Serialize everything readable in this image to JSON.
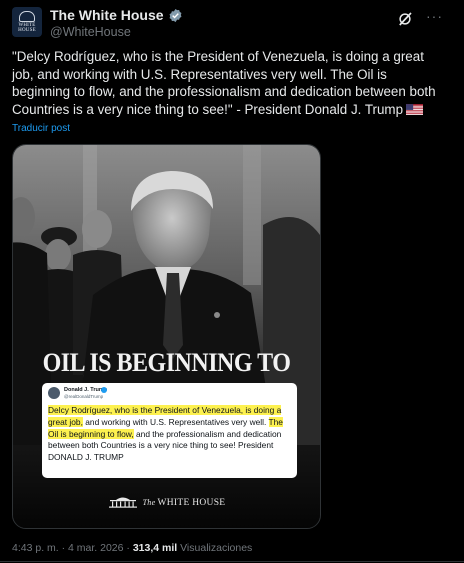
{
  "account": {
    "display_name": "The White House",
    "handle": "@WhiteHouse",
    "avatar_line1": "THE",
    "avatar_line2": "WHITE",
    "avatar_line3": "HOUSE"
  },
  "post": {
    "text": "\"Delcy Rodríguez, who is the President of Venezuela, is doing a great job, and working with U.S. Representatives very well. The Oil is beginning to flow, and the professionalism and dedication between both Countries is a very nice thing to see!\" - President Donald J. Trump",
    "translate_label": "Traducir post"
  },
  "media": {
    "headline": "OIL IS BEGINNING TO FLOW",
    "card_name": "Donald J. Trump",
    "card_handle": "@realDonaldTrump",
    "card_text_h1": "Delcy Rodríguez, who is the President of Venezuela, is doing a great job,",
    "card_text_p1": " and working with U.S. Representatives very well. ",
    "card_text_h2": "The Oil is beginning to flow,",
    "card_text_p2": " and the professionalism and dedication between both Countries is a very nice thing to see! President DONALD J. TRUMP",
    "footer_the": "The",
    "footer_brand": "WHITE HOUSE"
  },
  "meta": {
    "timestamp": "4:43 p. m. · 4 mar. 2026",
    "separator": " · ",
    "views_count": "313,4 mil",
    "views_label": " Visualizaciones"
  },
  "colors": {
    "background": "#000000",
    "text": "#e7e9ea",
    "muted": "#71767b",
    "link": "#1d9bf0",
    "highlight": "#fdf14f"
  },
  "icons": [
    "verified-badge-icon",
    "grok-icon",
    "more-icon",
    "us-flag-icon",
    "white-house-logo-icon"
  ]
}
